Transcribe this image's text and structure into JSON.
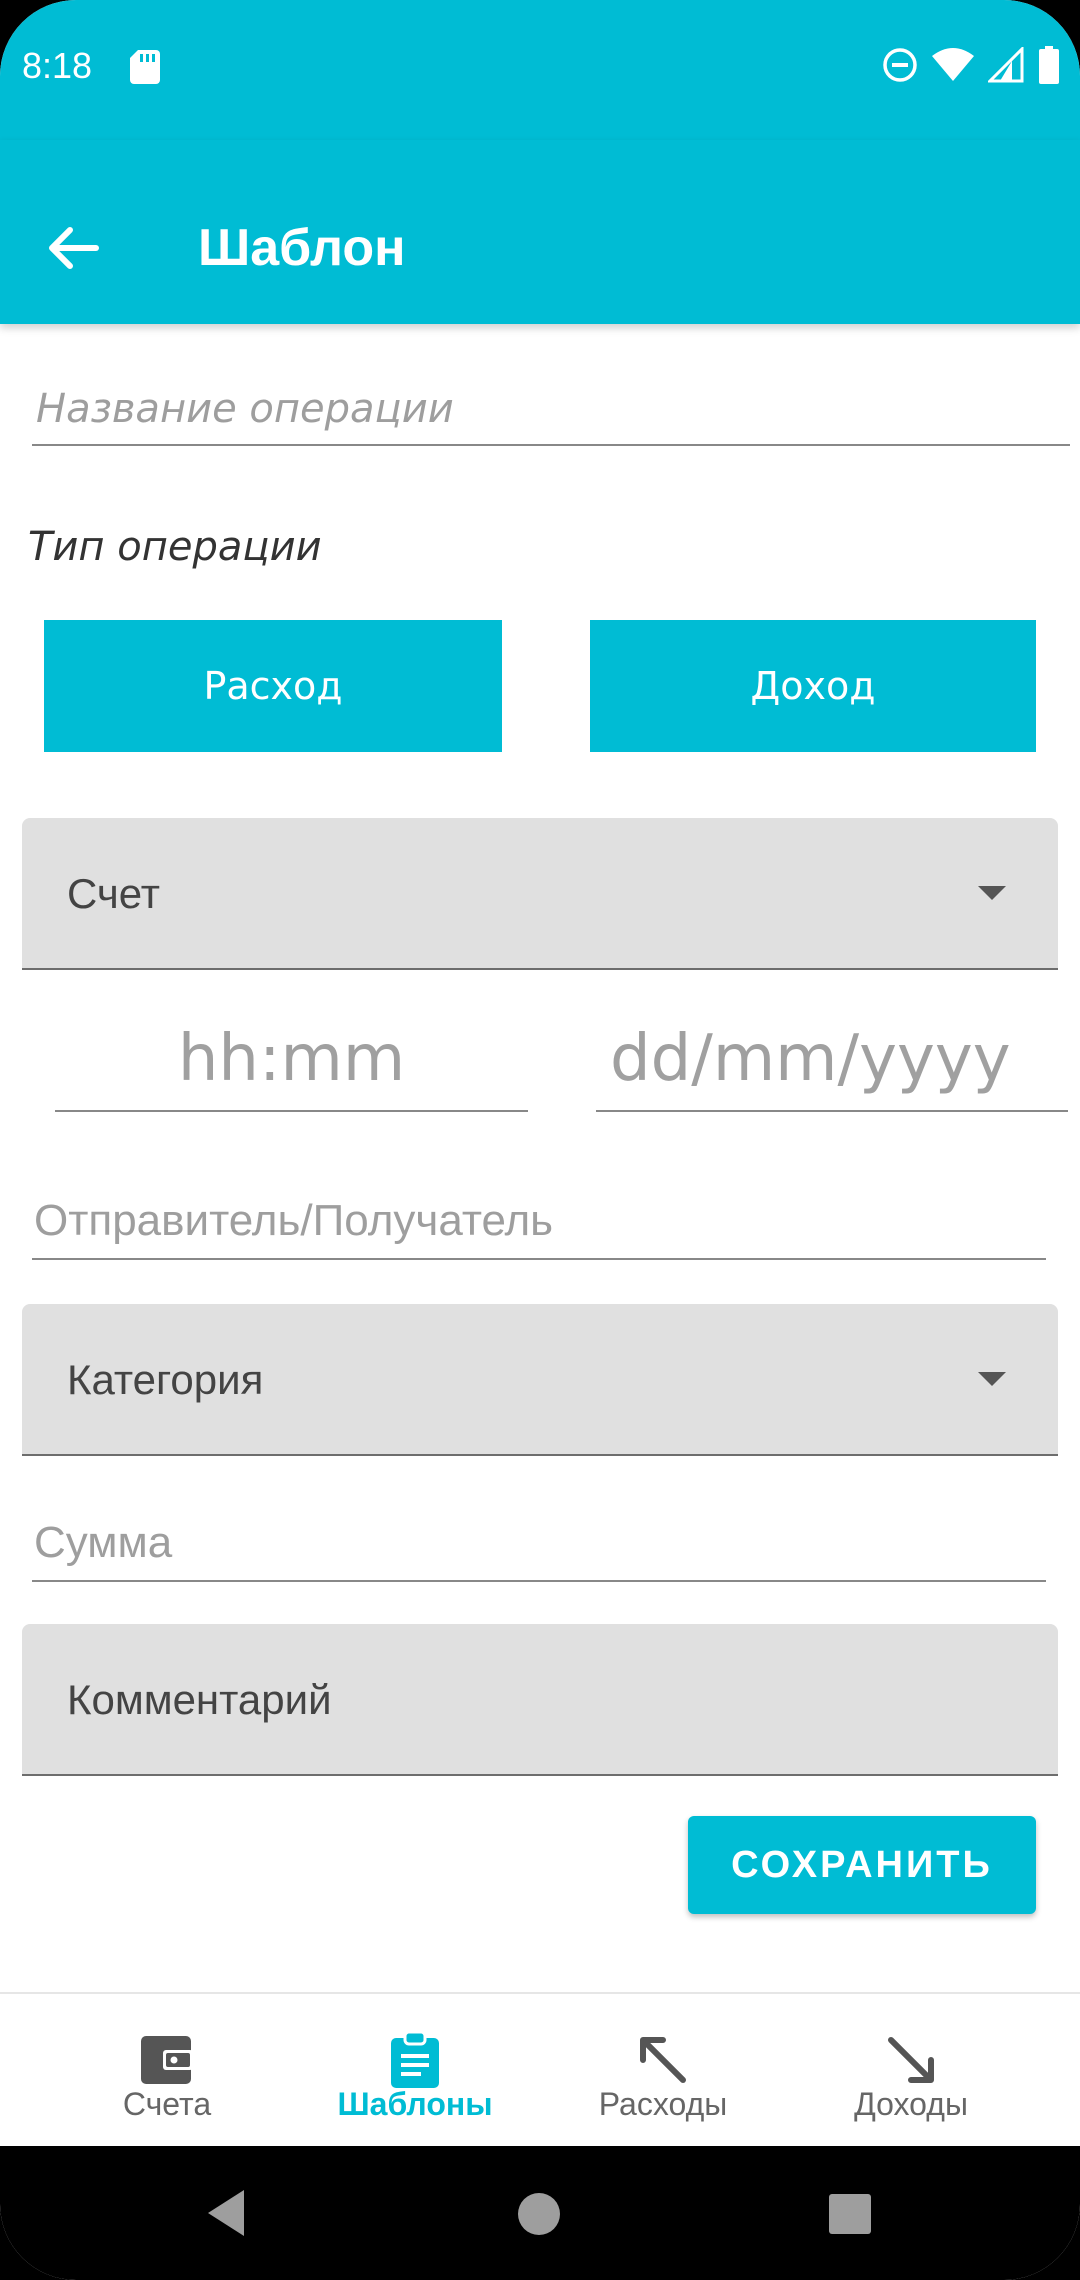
{
  "status_bar": {
    "time": "8:18",
    "icons": [
      "sd-card-icon",
      "do-not-disturb-icon",
      "wifi-icon",
      "signal-icon",
      "battery-icon"
    ]
  },
  "app_bar": {
    "title": "Шаблон",
    "back_icon": "arrow-back-icon"
  },
  "form": {
    "operation_name_placeholder": "Название операции",
    "operation_type_label": "Тип операции",
    "expense_button": "Расход",
    "income_button": "Доход",
    "account_label": "Счет",
    "time_placeholder": "hh:mm",
    "date_placeholder": "dd/mm/yyyy",
    "counterparty_placeholder": "Отправитель/Получатель",
    "category_label": "Категория",
    "amount_placeholder": "Сумма",
    "comment_label": "Комментарий",
    "save_button": "СОХРАНИТЬ"
  },
  "bottom_nav": {
    "items": [
      {
        "label": "Счета",
        "icon": "wallet-icon",
        "active": false
      },
      {
        "label": "Шаблоны",
        "icon": "clipboard-icon",
        "active": true
      },
      {
        "label": "Расходы",
        "icon": "arrow-up-left-icon",
        "active": false
      },
      {
        "label": "Доходы",
        "icon": "arrow-down-right-icon",
        "active": false
      }
    ]
  },
  "colors": {
    "accent": "#00bcd4",
    "field_fill": "#e0e0e0",
    "nav_inactive": "#666666"
  }
}
